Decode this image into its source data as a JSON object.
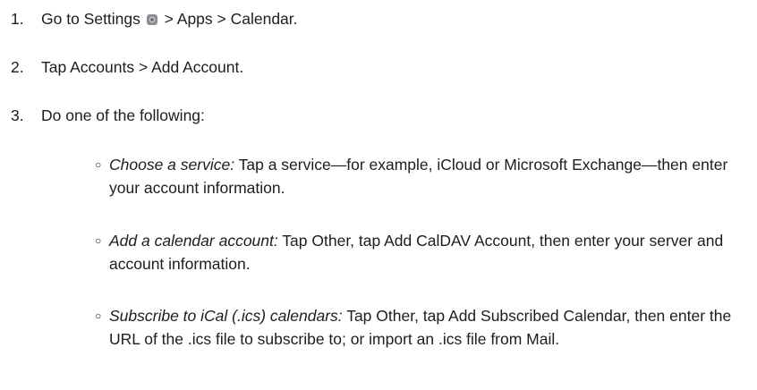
{
  "steps": [
    {
      "number": "1.",
      "before_icon": "Go to Settings",
      "icon": "settings-gear-icon",
      "after_icon": "> Apps > Calendar."
    },
    {
      "number": "2.",
      "text": "Tap Accounts > Add Account."
    },
    {
      "number": "3.",
      "text": "Do one of the following:"
    }
  ],
  "options": [
    {
      "title": "Choose a service:",
      "text": "Tap a service—for example, iCloud or Microsoft Exchange—then enter your account information."
    },
    {
      "title": "Add a calendar account:",
      "text": "Tap Other, tap Add CalDAV Account, then enter your server and account information."
    },
    {
      "title": "Subscribe to iCal (.ics) calendars:",
      "text": "Tap Other, tap Add Subscribed Calendar, then enter the URL of the .ics file to subscribe to; or import an .ics file from Mail."
    }
  ]
}
